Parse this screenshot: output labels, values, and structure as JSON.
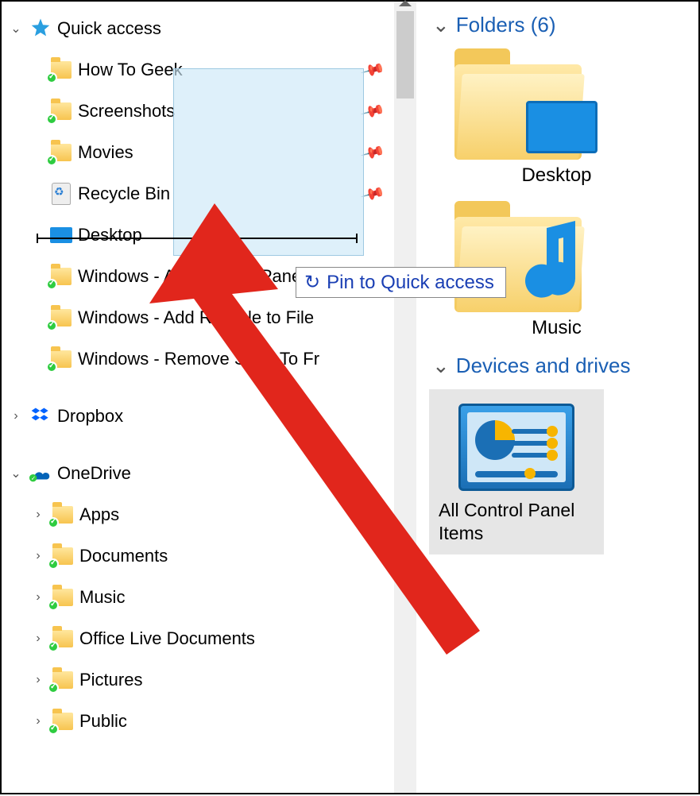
{
  "nav": {
    "quick_access": {
      "label": "Quick access",
      "items": [
        {
          "label": "How To Geek",
          "icon": "folder-check",
          "pinned": true
        },
        {
          "label": "Screenshots",
          "icon": "folder-check",
          "pinned": true
        },
        {
          "label": "Movies",
          "icon": "folder-check",
          "pinned": true
        },
        {
          "label": "Recycle Bin",
          "icon": "recycle",
          "pinned": true
        },
        {
          "label": "Desktop",
          "icon": "desktop",
          "pinned": false
        },
        {
          "label": "Windows - Add Control Panel",
          "icon": "folder-check",
          "pinned": false
        },
        {
          "label": "Windows - Add Recycle to File",
          "icon": "folder-check",
          "pinned": false
        },
        {
          "label": "Windows - Remove Send To Fr",
          "icon": "folder-check",
          "pinned": false
        }
      ]
    },
    "dropbox": {
      "label": "Dropbox"
    },
    "onedrive": {
      "label": "OneDrive",
      "items": [
        {
          "label": "Apps"
        },
        {
          "label": "Documents"
        },
        {
          "label": "Music"
        },
        {
          "label": "Office Live Documents"
        },
        {
          "label": "Pictures"
        },
        {
          "label": "Public"
        }
      ]
    }
  },
  "content": {
    "folders_header": "Folders (6)",
    "folders": [
      {
        "label": "Desktop",
        "overlay": "monitor"
      },
      {
        "label": "Music",
        "overlay": "note"
      }
    ],
    "devices_header": "Devices and drives",
    "devices": [
      {
        "label": "All Control Panel Items",
        "icon": "control-panel"
      }
    ]
  },
  "drag": {
    "tooltip": "Pin to Quick access"
  }
}
